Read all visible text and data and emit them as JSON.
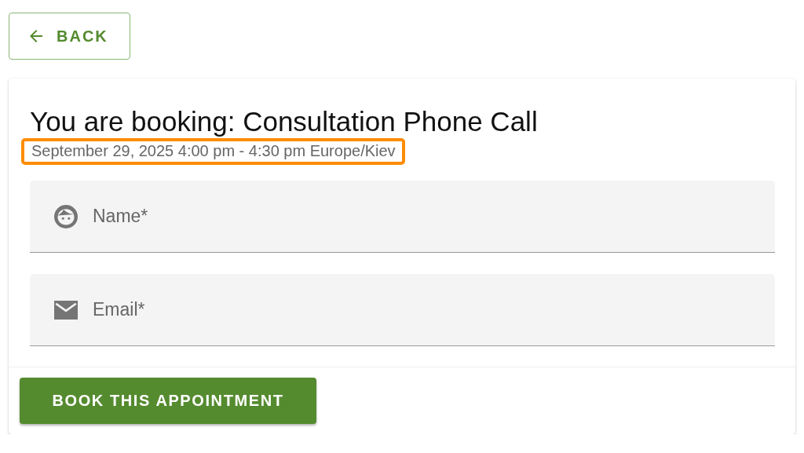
{
  "back_button": {
    "label": "BACK"
  },
  "booking": {
    "title": "You are booking: Consultation Phone Call",
    "datetime": "September 29, 2025 4:00 pm - 4:30 pm Europe/Kiev",
    "datetime_highlighted": true
  },
  "fields": [
    {
      "kind": "person",
      "placeholder": "Name*"
    },
    {
      "kind": "email",
      "placeholder": "Email*"
    }
  ],
  "submit_button": {
    "label": "BOOK THIS APPOINTMENT"
  }
}
